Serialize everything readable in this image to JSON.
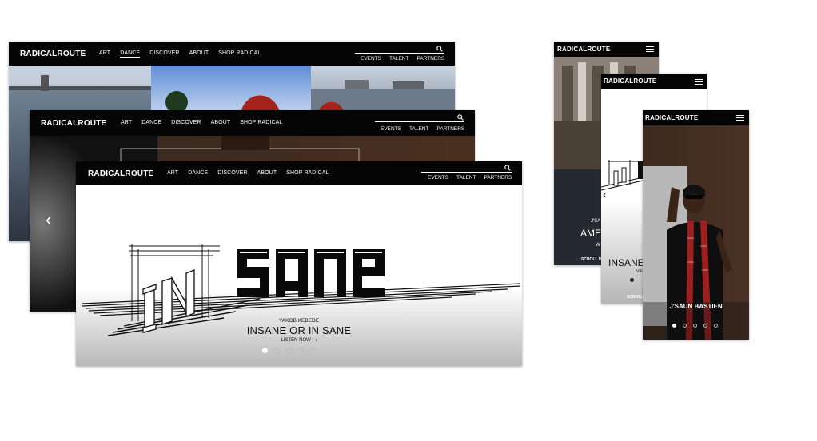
{
  "site": {
    "brand": "RADICALROUTE",
    "nav": [
      "ART",
      "DANCE",
      "DISCOVER",
      "ABOUT",
      "SHOP RADICAL"
    ],
    "util": [
      "EVENTS",
      "TALENT",
      "PARTNERS"
    ]
  },
  "desktop_front": {
    "hero_logo_in": "IN",
    "hero_logo_sane": "sane",
    "artist": "YAKOB KEBEDE",
    "title": "INSANE OR IN SANE",
    "cta": "LISTEN NOW",
    "cta_arrow": "›",
    "slides": 5,
    "active_slide": 1
  },
  "desktop_middle": {
    "prev_arrow": "‹"
  },
  "mobile_back": {
    "eyebrow": "J'SA",
    "title": "AME",
    "sub": "W",
    "scroll": "SCROLL D"
  },
  "mobile_middle": {
    "title": "INSANE",
    "sub": "VIE",
    "scroll": "SCROLL",
    "prev_arrow": "‹"
  },
  "mobile_front": {
    "caption": "J'SAUN BASTIEN",
    "slides": 5,
    "active_slide": 1
  },
  "colors": {
    "nav_bg": "#050505",
    "text_light": "#ffffff",
    "text_dark": "#111111"
  }
}
